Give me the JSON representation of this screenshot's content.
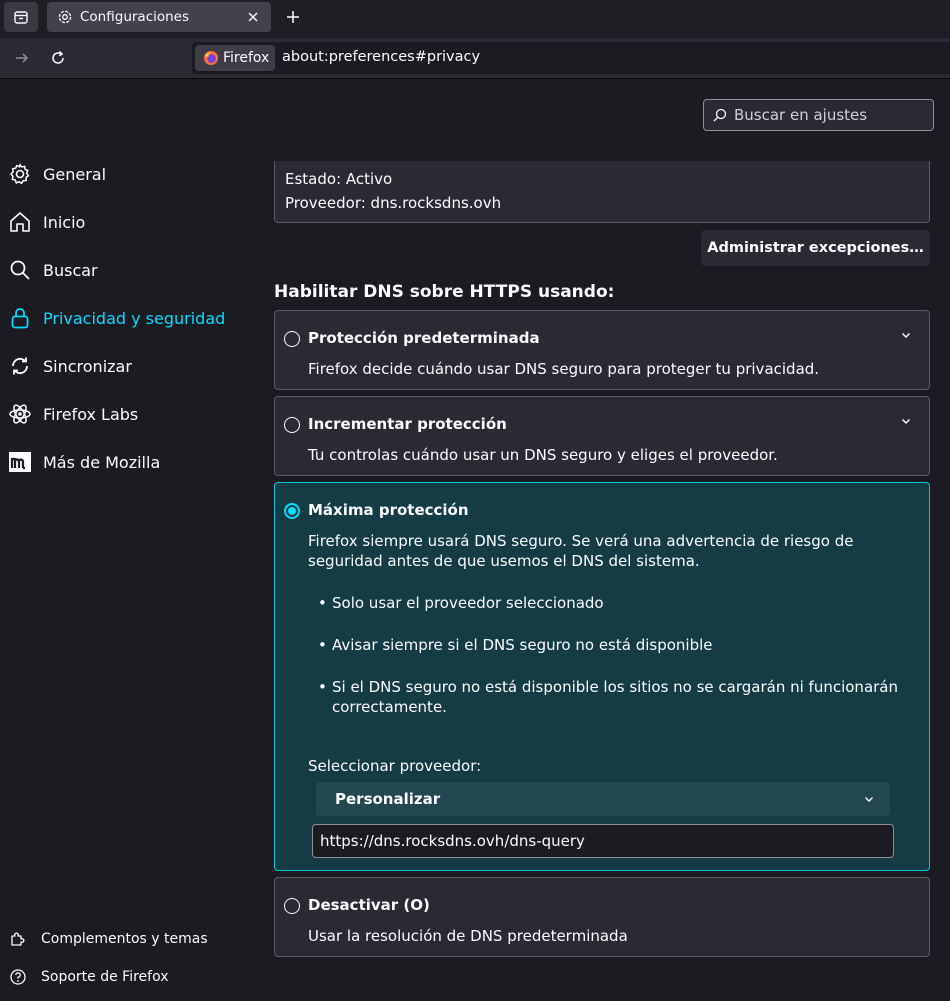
{
  "tab": {
    "title": "Configuraciones"
  },
  "navbar": {
    "identity_label": "Firefox",
    "url": "about:preferences#privacy"
  },
  "search": {
    "placeholder": "Buscar en ajustes"
  },
  "sidebar": {
    "items": [
      {
        "label": "General",
        "icon": "gear-icon"
      },
      {
        "label": "Inicio",
        "icon": "home-icon"
      },
      {
        "label": "Buscar",
        "icon": "search-icon"
      },
      {
        "label": "Privacidad y seguridad",
        "icon": "lock-icon",
        "selected": true
      },
      {
        "label": "Sincronizar",
        "icon": "sync-icon"
      },
      {
        "label": "Firefox Labs",
        "icon": "labs-icon"
      },
      {
        "label": "Más de Mozilla",
        "icon": "mozilla-icon"
      }
    ],
    "footer": [
      {
        "label": "Complementos y temas",
        "icon": "puzzle-icon"
      },
      {
        "label": "Soporte de Firefox",
        "icon": "help-icon"
      }
    ]
  },
  "status": {
    "state": "Estado: Activo",
    "provider": "Proveedor: dns.rocksdns.ovh"
  },
  "exceptions_button": "Administrar excepciones…",
  "section_title": "Habilitar DNS sobre HTTPS usando:",
  "options": {
    "default": {
      "title": "Protección predeterminada",
      "desc": "Firefox decide cuándo usar DNS seguro para proteger tu privacidad."
    },
    "increased": {
      "title": "Incrementar protección",
      "desc": "Tu controlas cuándo usar un DNS seguro y eliges el proveedor."
    },
    "max": {
      "title": "Máxima protección",
      "desc": "Firefox siempre usará DNS seguro. Se verá una advertencia de riesgo de seguridad antes de que usemos el DNS del sistema.",
      "bullets": [
        "Solo usar el proveedor seleccionado",
        "Avisar siempre si el DNS seguro no está disponible",
        "Si el DNS seguro no está disponible los sitios no se cargarán ni funcionarán correctamente."
      ],
      "provider_label": "Seleccionar proveedor:",
      "provider_value": "Personalizar",
      "custom_url": "https://dns.rocksdns.ovh/dns-query"
    },
    "off": {
      "title": "Desactivar (O)",
      "desc": "Usar la resolución de DNS predeterminada"
    }
  },
  "colors": {
    "accent": "#00ddff",
    "selected_card_bg": "#153c45",
    "selected_card_border": "#00c8d7"
  }
}
